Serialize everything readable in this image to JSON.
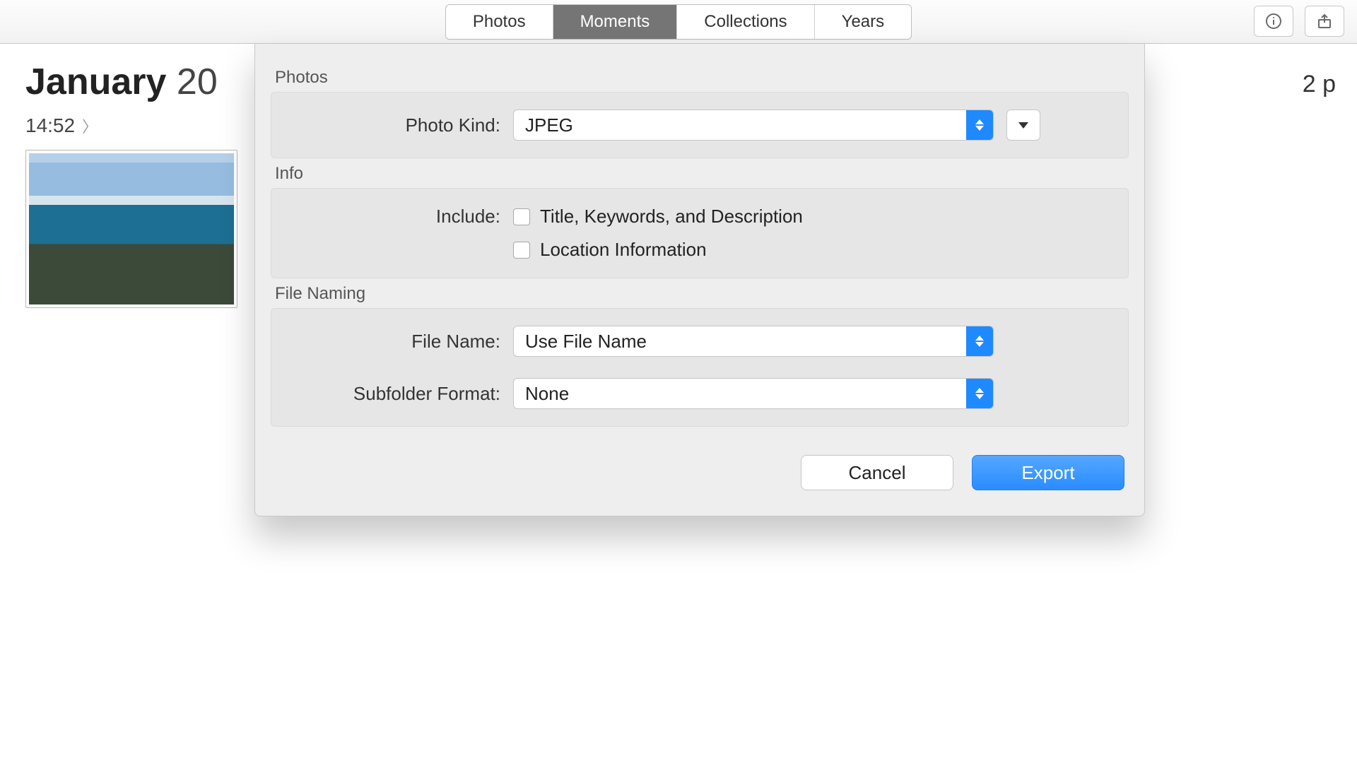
{
  "toolbar": {
    "tabs": [
      "Photos",
      "Moments",
      "Collections",
      "Years"
    ],
    "active_index": 1
  },
  "header": {
    "month": "January",
    "year_partial": "20",
    "time": "14:52",
    "count_partial": "2 p"
  },
  "dialog": {
    "sections": {
      "photos": {
        "label": "Photos",
        "photo_kind_label": "Photo Kind:",
        "photo_kind_value": "JPEG"
      },
      "info": {
        "label": "Info",
        "include_label": "Include:",
        "opt_title": "Title, Keywords, and Description",
        "opt_location": "Location Information"
      },
      "file_naming": {
        "label": "File Naming",
        "file_name_label": "File Name:",
        "file_name_value": "Use File Name",
        "subfolder_label": "Subfolder Format:",
        "subfolder_value": "None"
      }
    },
    "buttons": {
      "cancel": "Cancel",
      "export": "Export"
    }
  }
}
